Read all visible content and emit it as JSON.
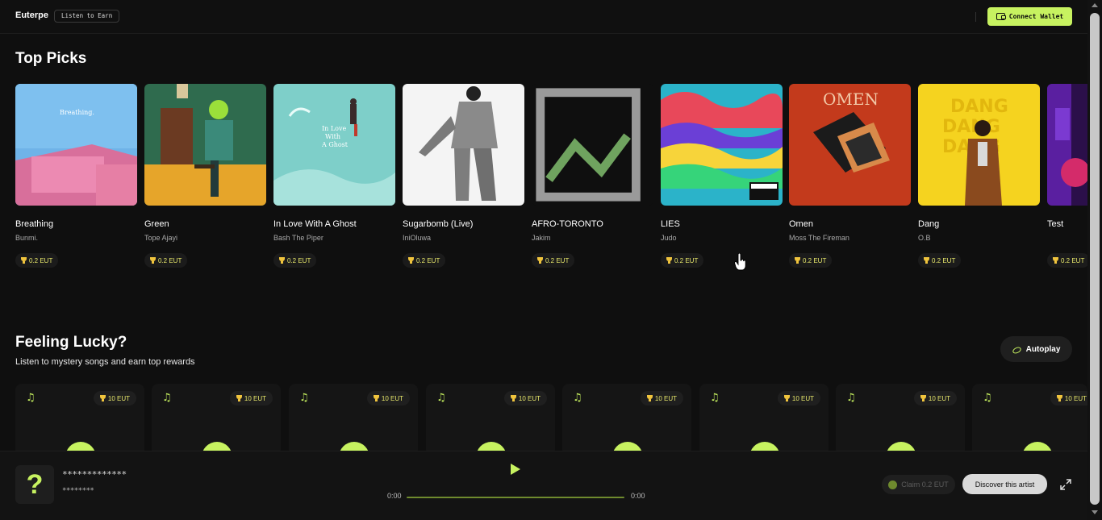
{
  "header": {
    "brand": "Euterpe",
    "tag": "Listen to Earn",
    "connect_label": "Connect Wallet",
    "accent": "#c7f260"
  },
  "top_picks": {
    "title": "Top Picks",
    "items": [
      {
        "title": "Breathing",
        "artist": "Bunmi.",
        "reward": "0.2 EUT"
      },
      {
        "title": "Green",
        "artist": "Tope Ajayi",
        "reward": "0.2 EUT"
      },
      {
        "title": "In Love With A Ghost",
        "artist": "Bash The Piper",
        "reward": "0.2 EUT"
      },
      {
        "title": "Sugarbomb (Live)",
        "artist": "IniOluwa",
        "reward": "0.2 EUT"
      },
      {
        "title": "AFRO-TORONTO",
        "artist": "Jakim",
        "reward": "0.2 EUT"
      },
      {
        "title": "LIES",
        "artist": "Judo",
        "reward": "0.2 EUT"
      },
      {
        "title": "Omen",
        "artist": "Moss The Fireman",
        "reward": "0.2 EUT"
      },
      {
        "title": "Dang",
        "artist": "O.B",
        "reward": "0.2 EUT"
      },
      {
        "title": "Test",
        "artist": "",
        "reward": "0.2 EUT"
      }
    ]
  },
  "feeling_lucky": {
    "title": "Feeling Lucky?",
    "subtitle": "Listen to mystery songs and earn top rewards",
    "autoplay_label": "Autoplay",
    "cards": [
      {
        "reward": "10 EUT"
      },
      {
        "reward": "10 EUT"
      },
      {
        "reward": "10 EUT"
      },
      {
        "reward": "10 EUT"
      },
      {
        "reward": "10 EUT"
      },
      {
        "reward": "10 EUT"
      },
      {
        "reward": "10 EUT"
      },
      {
        "reward": "10 EUT"
      }
    ]
  },
  "player": {
    "cover_symbol": "?",
    "title": "*************",
    "artist": "********",
    "time_current": "0:00",
    "time_total": "0:00",
    "progress": 0,
    "claim_label": "Claim 0.2 EUT",
    "discover_label": "Discover this artist"
  }
}
